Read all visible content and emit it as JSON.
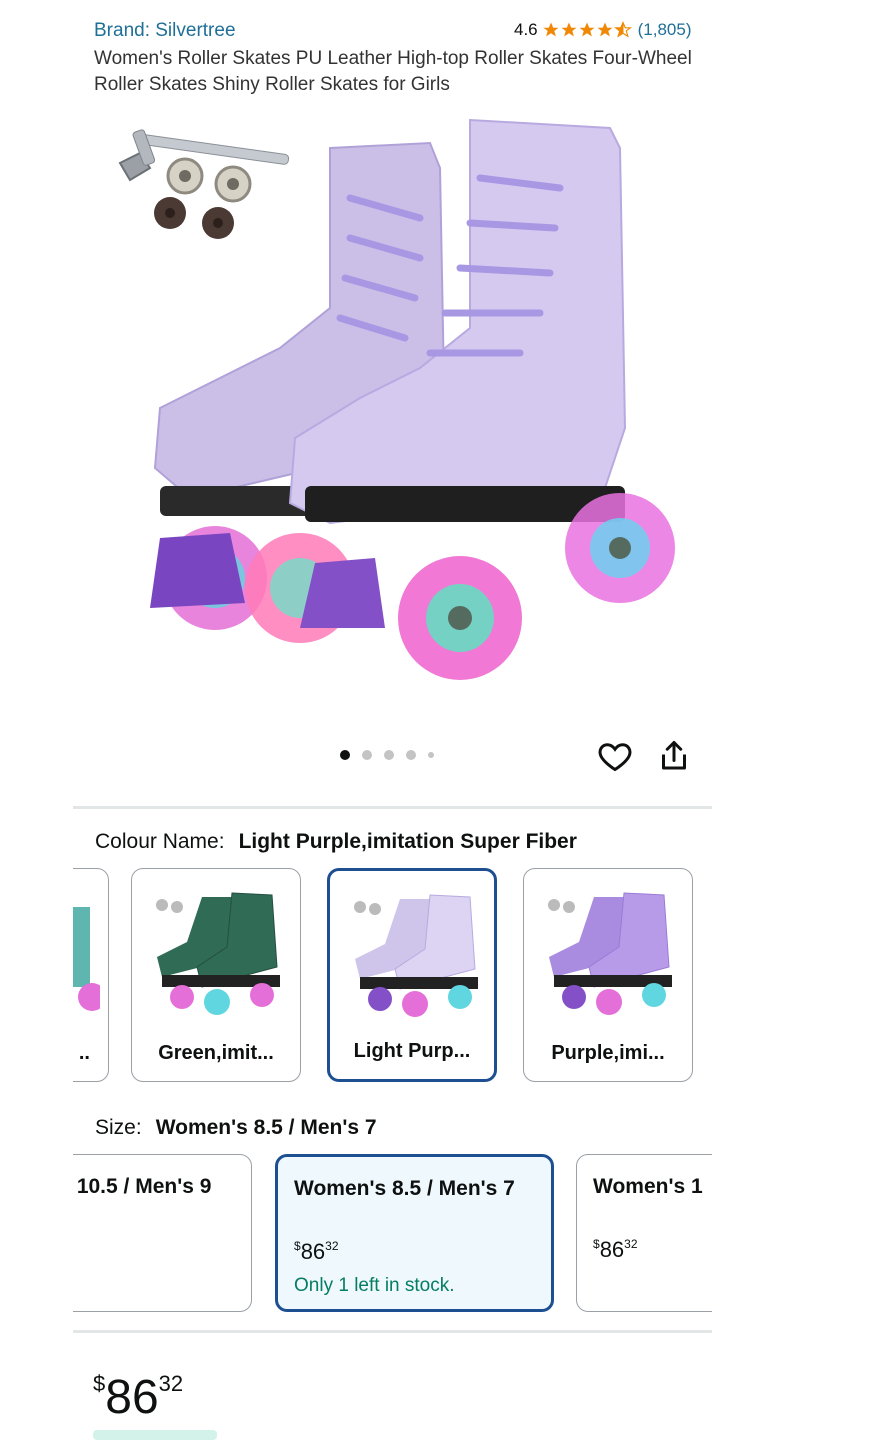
{
  "product": {
    "brand": "Brand: Silvertree",
    "rating_value": "4.6",
    "rating_stars": 4.6,
    "rating_count": "(1,805)",
    "title": "Women's Roller Skates PU Leather High-top Roller Skates Four-Wheel Roller Skates Shiny Roller Skates for Girls"
  },
  "gallery": {
    "image_count": 5,
    "active_index": 0
  },
  "colour": {
    "label": "Colour Name:",
    "selected": "Light Purple,imitation Super Fiber",
    "options": [
      {
        "name": "..",
        "color": "#5fb5b0"
      },
      {
        "name": "Green,imit...",
        "color": "#2f6b55"
      },
      {
        "name": "Light Purp...",
        "color": "#cfc4ea",
        "selected": true
      },
      {
        "name": "Purple,imi...",
        "color": "#a98be0"
      }
    ]
  },
  "size": {
    "label": "Size:",
    "selected": "Women's 8.5 / Men's 7",
    "options": [
      {
        "name": "; 10.5 / Men's 9",
        "price_whole": "",
        "price_cents": "",
        "stock": ""
      },
      {
        "name": "Women's 8.5 / Men's 7",
        "currency": "$",
        "price_whole": "86",
        "price_cents": "32",
        "stock": "Only 1 left in stock.",
        "selected": true
      },
      {
        "name": "Women's 1",
        "currency": "$",
        "price_whole": "86",
        "price_cents": "32",
        "stock": ""
      }
    ]
  },
  "price": {
    "currency": "$",
    "whole": "86",
    "cents": "32"
  },
  "colors": {
    "link": "#1f6f96",
    "star": "#f08804",
    "selected_border": "#1d4f91",
    "stock_green": "#067d62"
  }
}
